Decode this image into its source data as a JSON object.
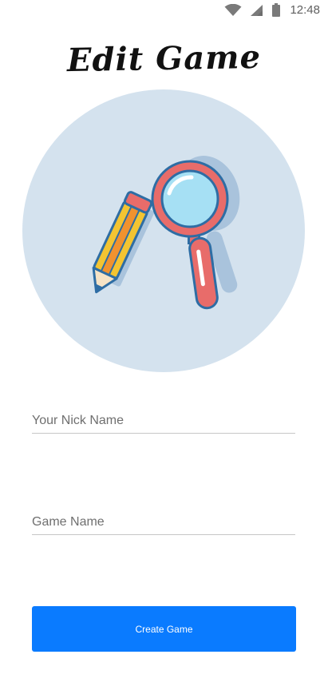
{
  "status_bar": {
    "time": "12:48",
    "icons": [
      "wifi-icon",
      "signal-icon",
      "battery-icon"
    ]
  },
  "header": {
    "title": "Edit Game"
  },
  "hero": {
    "icon_pencil": "pencil-icon",
    "icon_magnifier": "magnifier-icon",
    "circle_color": "#d4e2ee"
  },
  "form": {
    "nick_name": {
      "placeholder": "Your Nick Name",
      "value": ""
    },
    "game_name": {
      "placeholder": "Game Name",
      "value": ""
    },
    "submit_label": "Create Game"
  },
  "colors": {
    "accent": "#0a7bff",
    "underline": "#c6c6c6"
  }
}
